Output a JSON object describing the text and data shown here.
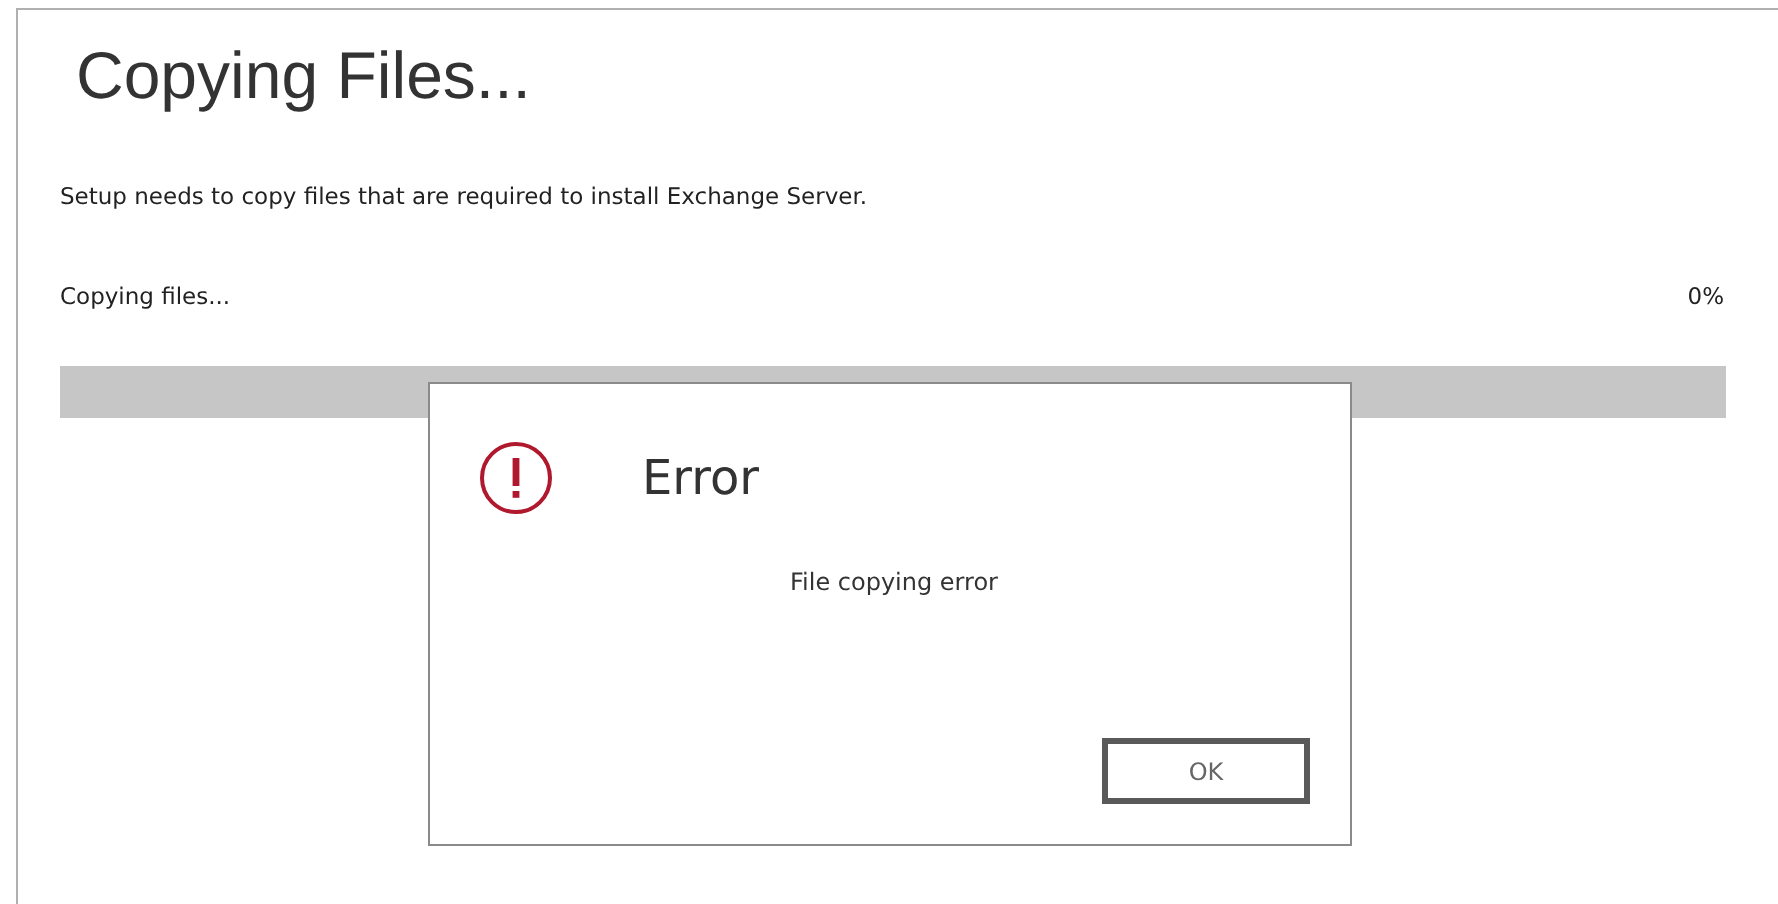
{
  "page": {
    "title": "Copying Files...",
    "description": "Setup needs to copy files that are required to install Exchange Server."
  },
  "progress": {
    "label": "Copying files...",
    "reading": "0%",
    "level": 0
  },
  "dialog": {
    "title": "Error",
    "message": "File copying error",
    "buttons": [
      "OK"
    ]
  }
}
